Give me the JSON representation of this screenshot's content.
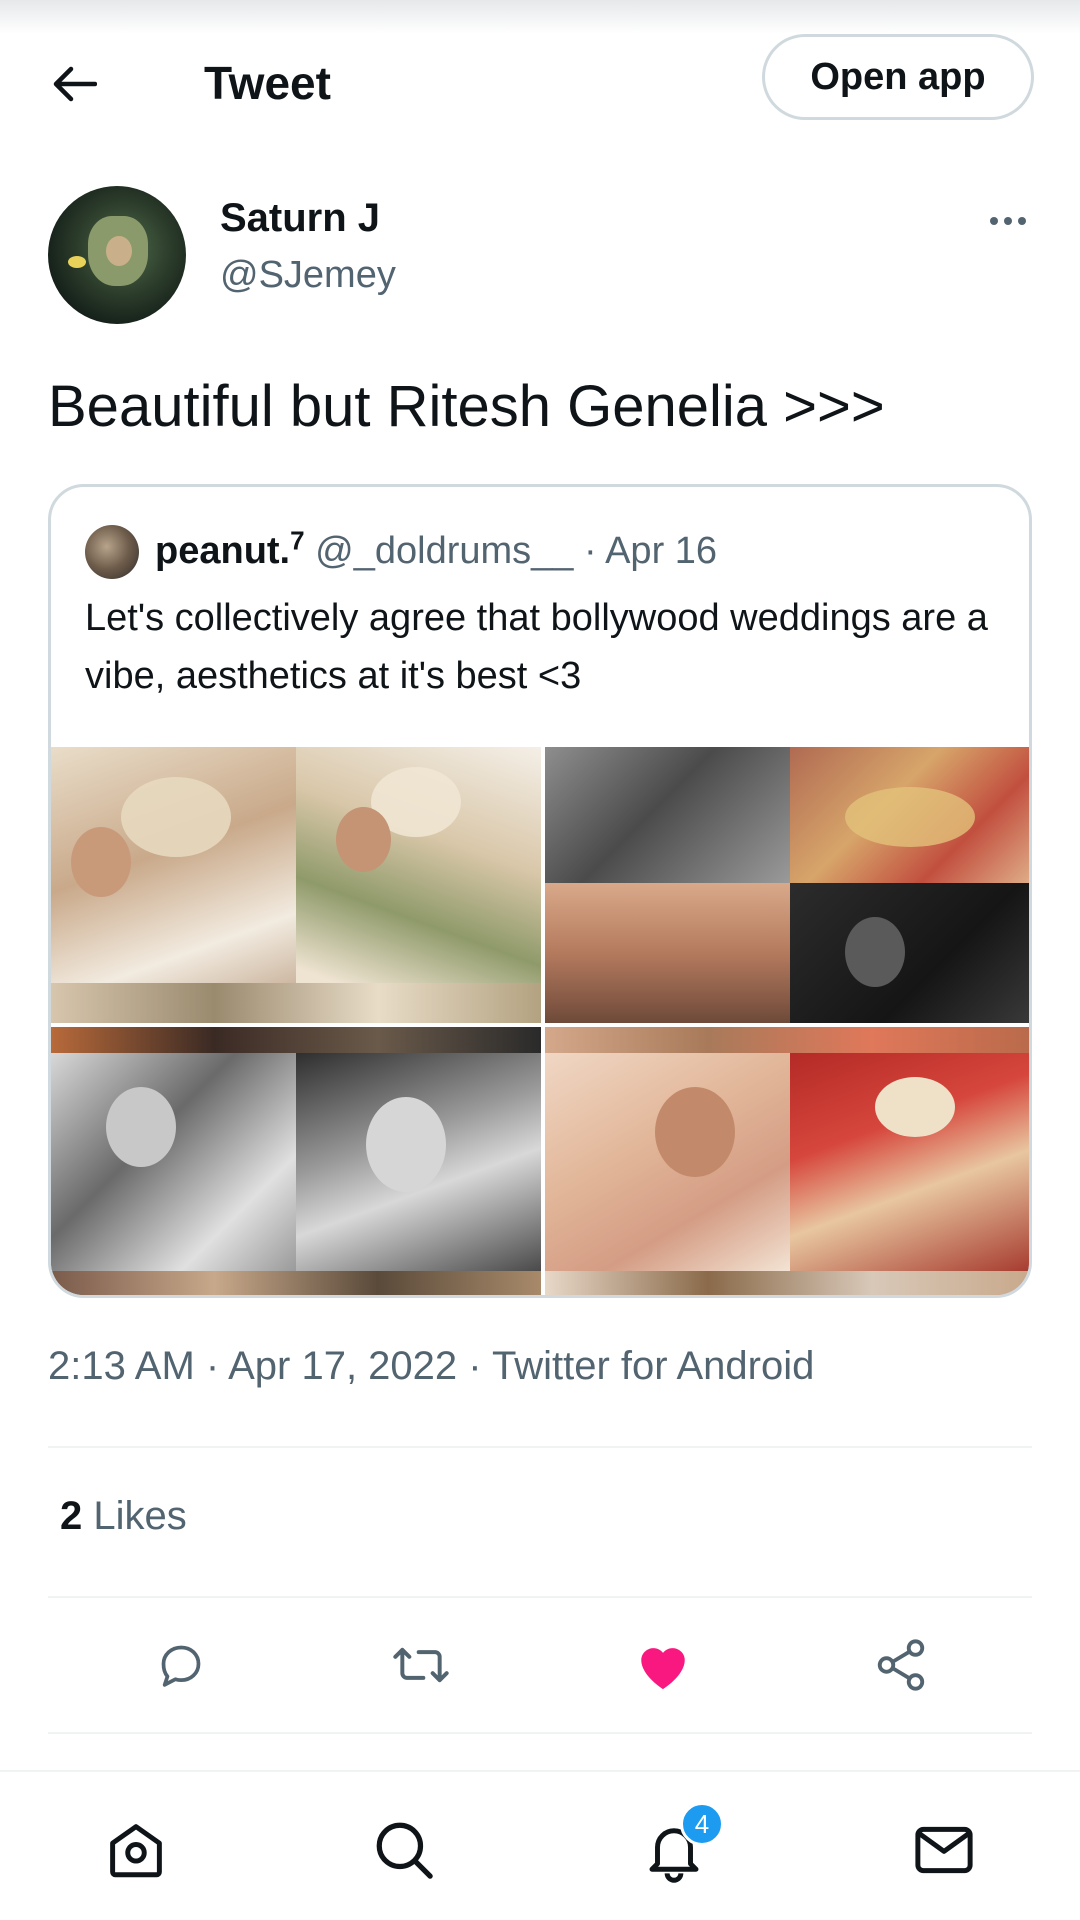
{
  "header": {
    "title": "Tweet",
    "open_app_label": "Open app"
  },
  "tweet": {
    "author_name": "Saturn J",
    "author_handle": "@SJemey",
    "text": "Beautiful but Ritesh Genelia >>>",
    "timestamp": "2:13 AM · Apr 17, 2022 · Twitter for Android",
    "likes_count": "2",
    "likes_label": " Likes"
  },
  "quoted_tweet": {
    "author_name": "peanut.",
    "author_sup": "7",
    "meta": " @_doldrums__ · Apr 16",
    "text": "Let's collectively agree that bollywood weddings are a vibe, aesthetics at it's best <3"
  },
  "colors": {
    "like_active": "#f91880",
    "accent": "#1d9bf0",
    "secondary_text": "#536471"
  },
  "actions": [
    "reply-icon",
    "retweet-icon",
    "like-icon",
    "share-icon"
  ],
  "bottom_nav": {
    "items": [
      "home-icon",
      "search-icon",
      "notifications-icon",
      "messages-icon"
    ],
    "notification_badge": "4"
  }
}
